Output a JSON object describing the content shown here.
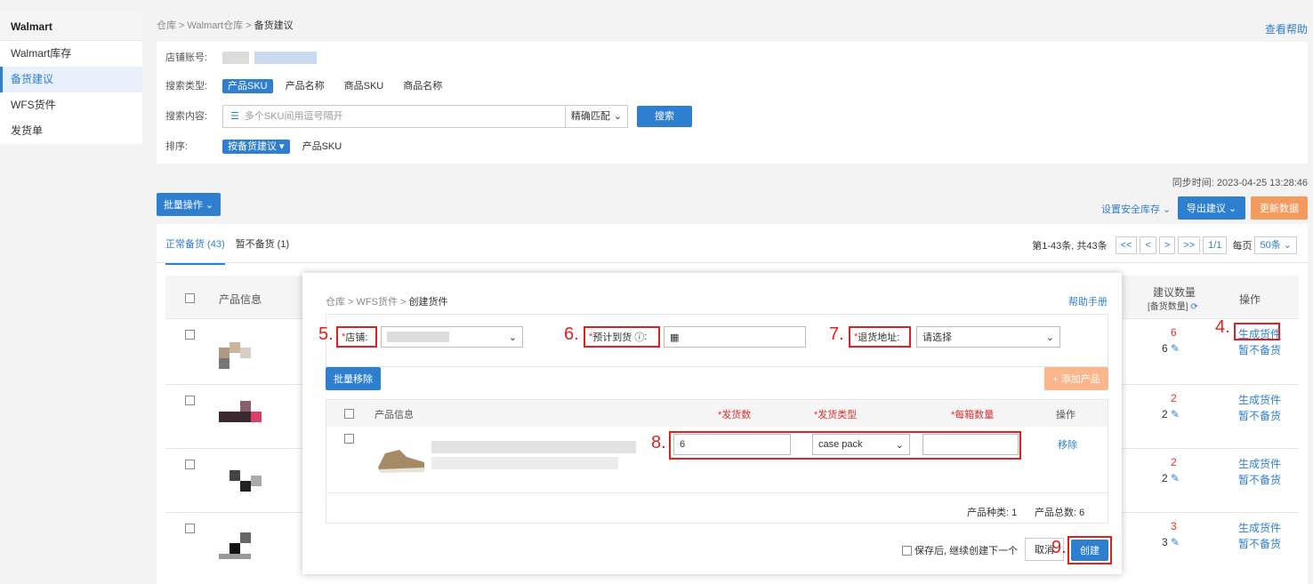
{
  "sidebar": {
    "title": "Walmart",
    "items": [
      "Walmart库存",
      "备货建议",
      "WFS货件",
      "发货单"
    ],
    "active_index": 1
  },
  "breadcrumb": {
    "path": "仓库 > Walmart仓库 > ",
    "current": "备货建议"
  },
  "help_link": "查看帮助",
  "filter": {
    "store_label": "店铺账号:",
    "search_type_label": "搜索类型:",
    "search_types": [
      "产品SKU",
      "产品名称",
      "商品SKU",
      "商品名称"
    ],
    "search_content_label": "搜索内容:",
    "search_placeholder": "多个SKU间用逗号隔开",
    "match_mode": "精确匹配",
    "search_button": "搜索",
    "sort_label": "排序:",
    "sort_options": [
      "按备货建议",
      "产品SKU"
    ]
  },
  "sync_time": "同步时间: 2023-04-25 13:28:46",
  "toolbar": {
    "batch": "批量操作",
    "safety": "设置安全库存",
    "export": "导出建议",
    "refresh": "更新数据"
  },
  "tabs": [
    "正常备货 (43)",
    "暂不备货 (1)"
  ],
  "pager": {
    "summary": "第1-43条, 共43条",
    "buttons": [
      "<<",
      "<",
      ">",
      ">>",
      "1/1"
    ],
    "per_page_label": "每页",
    "per_page": "50条"
  },
  "table": {
    "col_product": "产品信息",
    "col_qty": "建议数量",
    "col_qty_sub": "[备货数量]",
    "col_action": "操作",
    "rows": [
      {
        "suggest": "6",
        "stock": "6",
        "action1": "生成货件",
        "action2": "暂不备货"
      },
      {
        "suggest": "2",
        "stock": "2",
        "action1": "生成货件",
        "action2": "暂不备货"
      },
      {
        "suggest": "2",
        "stock": "2",
        "action1": "生成货件",
        "action2": "暂不备货"
      },
      {
        "suggest": "3",
        "stock": "3",
        "action1": "生成货件",
        "action2": "暂不备货"
      }
    ]
  },
  "modal": {
    "breadcrumb_path": "仓库 > WFS货件 > ",
    "breadcrumb_current": "创建货件",
    "help": "帮助手册",
    "store_label": "店铺:",
    "eta_label": "预计到货",
    "return_label": "退货地址:",
    "return_placeholder": "请选择",
    "required_mark": "*",
    "batch_remove": "批量移除",
    "add_product": "+ 添加产品",
    "cols": {
      "product": "产品信息",
      "ship_qty": "*发货数",
      "ship_type": "*发货类型",
      "per_box": "*每箱数量",
      "action": "操作"
    },
    "item": {
      "qty": "6",
      "type": "case pack",
      "per_box": "",
      "remove": "移除"
    },
    "summary": {
      "kinds": "产品种类: 1",
      "total": "产品总数: 6"
    },
    "save_next": "保存后, 继续创建下一个",
    "cancel": "取消",
    "create": "创建"
  },
  "annotations": [
    "4.",
    "5.",
    "6.",
    "7.",
    "8.",
    "9."
  ],
  "colors": {
    "accent": "#2f7fd0",
    "annotation": "#e02020",
    "orange": "#f39a5d"
  }
}
